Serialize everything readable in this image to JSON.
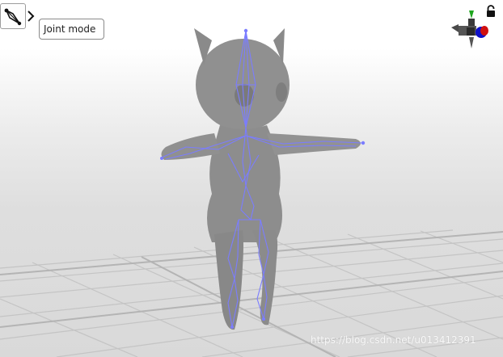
{
  "toolbar": {
    "mode_button_icon": "joint-mode-icon",
    "expand_icon": "chevron-right-icon",
    "tooltip": "Joint mode"
  },
  "viewport": {
    "lock_icon": "lock-icon",
    "gizmo_icon": "axis-gizmo-icon",
    "colors": {
      "skeleton": "#7b7dff",
      "model": "#8c8c8c",
      "grid": "#c2c2c2",
      "axis_y": "#1fa61f",
      "axis_x": "#d01010",
      "axis_z": "#1010c8"
    }
  },
  "watermark": "https://blog.csdn.net/u013412391"
}
